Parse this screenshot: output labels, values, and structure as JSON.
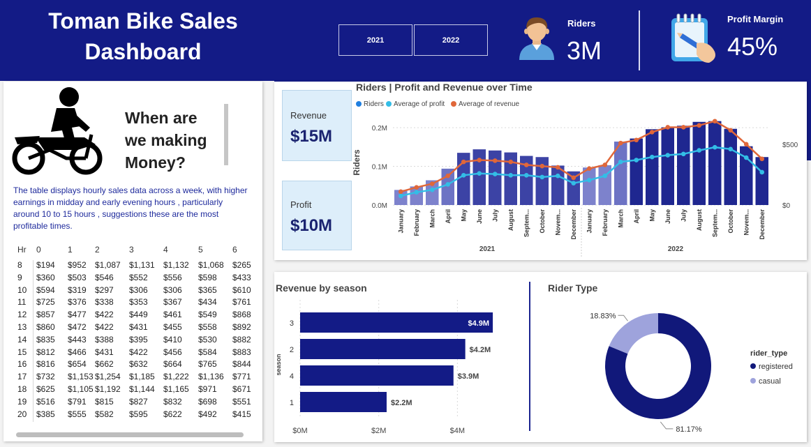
{
  "header": {
    "title": "Toman Bike Sales Dashboard",
    "years": [
      "2021",
      "2022"
    ],
    "riders_label": "Riders",
    "riders_value": "3M",
    "profit_margin_label": "Profit Margin",
    "profit_margin_value": "45%"
  },
  "left_panel": {
    "question": "When are we making Money?",
    "description": "The table displays hourly sales data across a week, with higher earnings in midday and early evening hours , particularly around 10 to 15 hours , suggestions these are the most profitable times.",
    "table": {
      "headers": [
        "Hr",
        "0",
        "1",
        "2",
        "3",
        "4",
        "5",
        "6"
      ],
      "rows": [
        [
          "8",
          "$194",
          "$952",
          "$1,087",
          "$1,131",
          "$1,132",
          "$1,068",
          "$265"
        ],
        [
          "9",
          "$360",
          "$503",
          "$546",
          "$552",
          "$556",
          "$598",
          "$433"
        ],
        [
          "10",
          "$594",
          "$319",
          "$297",
          "$306",
          "$306",
          "$365",
          "$610"
        ],
        [
          "11",
          "$725",
          "$376",
          "$338",
          "$353",
          "$367",
          "$434",
          "$761"
        ],
        [
          "12",
          "$857",
          "$477",
          "$422",
          "$449",
          "$461",
          "$549",
          "$868"
        ],
        [
          "13",
          "$860",
          "$472",
          "$422",
          "$431",
          "$455",
          "$558",
          "$892"
        ],
        [
          "14",
          "$835",
          "$443",
          "$388",
          "$395",
          "$410",
          "$530",
          "$882"
        ],
        [
          "15",
          "$812",
          "$466",
          "$431",
          "$422",
          "$456",
          "$584",
          "$883"
        ],
        [
          "16",
          "$816",
          "$654",
          "$662",
          "$632",
          "$664",
          "$765",
          "$844"
        ],
        [
          "17",
          "$732",
          "$1,153",
          "$1,254",
          "$1,185",
          "$1,222",
          "$1,136",
          "$771"
        ],
        [
          "18",
          "$625",
          "$1,105",
          "$1,192",
          "$1,144",
          "$1,165",
          "$971",
          "$671"
        ],
        [
          "19",
          "$516",
          "$791",
          "$815",
          "$827",
          "$832",
          "$698",
          "$551"
        ],
        [
          "20",
          "$385",
          "$555",
          "$582",
          "$595",
          "$622",
          "$492",
          "$415"
        ]
      ]
    }
  },
  "kpis": {
    "revenue_label": "Revenue",
    "revenue_value": "$15M",
    "profit_label": "Profit",
    "profit_value": "$10M"
  },
  "colors": {
    "navy": "#131b86",
    "bar_2021_light": "#6d73c4",
    "bar_dark": "#232a90",
    "riders_legend": "#1f7fe0",
    "profit_line": "#33bde6",
    "revenue_line": "#e0673a",
    "casual": "#9ea3dc",
    "registered": "#11187a"
  },
  "chart_data": [
    {
      "type": "bar",
      "title": "Riders | Profit and Revenue over Time",
      "ylabel": "Riders",
      "legend": [
        "Riders",
        "Average of profit",
        "Average of revenue"
      ],
      "legend_placement": "top-left",
      "y_ticks": [
        "0.0M",
        "0.1M",
        "0.2M"
      ],
      "y2_ticks": [
        "$0",
        "$500"
      ],
      "ylim": [
        0,
        0.22
      ],
      "y2lim": [
        0,
        700
      ],
      "categories": [
        "January",
        "February",
        "March",
        "April",
        "May",
        "June",
        "July",
        "August",
        "Septem...",
        "October",
        "Novem...",
        "December",
        "January",
        "February",
        "March",
        "April",
        "May",
        "June",
        "July",
        "August",
        "Septem...",
        "October",
        "Novem...",
        "December"
      ],
      "groups": [
        "2021",
        "2022"
      ],
      "series": [
        {
          "name": "Riders",
          "values": [
            0.039,
            0.048,
            0.064,
            0.094,
            0.135,
            0.144,
            0.141,
            0.136,
            0.127,
            0.124,
            0.102,
            0.087,
            0.097,
            0.103,
            0.164,
            0.172,
            0.196,
            0.201,
            0.205,
            0.215,
            0.217,
            0.197,
            0.152,
            0.124
          ]
        },
        {
          "name": "Average of profit",
          "values": [
            75,
            105,
            125,
            170,
            245,
            260,
            255,
            245,
            245,
            230,
            240,
            180,
            205,
            240,
            355,
            370,
            395,
            410,
            420,
            450,
            475,
            460,
            390,
            270
          ]
        },
        {
          "name": "Average of revenue",
          "values": [
            110,
            145,
            175,
            240,
            355,
            370,
            365,
            355,
            330,
            320,
            310,
            225,
            300,
            330,
            510,
            535,
            600,
            640,
            640,
            655,
            690,
            615,
            500,
            380
          ]
        }
      ]
    },
    {
      "type": "bar",
      "title": "Revenue by season",
      "ylabel": "season",
      "categories": [
        "3",
        "2",
        "4",
        "1"
      ],
      "values": [
        4.9,
        4.2,
        3.9,
        2.2
      ],
      "value_labels": [
        "$4.9M",
        "$4.2M",
        "$3.9M",
        "$2.2M"
      ],
      "x_ticks": [
        "$0M",
        "$2M",
        "$4M"
      ],
      "xlim": [
        0,
        5.2
      ]
    },
    {
      "type": "pie",
      "title": "Rider Type",
      "legend_title": "rider_type",
      "legend": [
        "registered",
        "casual"
      ],
      "categories": [
        "registered",
        "casual"
      ],
      "values": [
        81.17,
        18.83
      ],
      "value_labels": [
        "81.17%",
        "18.83%"
      ]
    }
  ]
}
